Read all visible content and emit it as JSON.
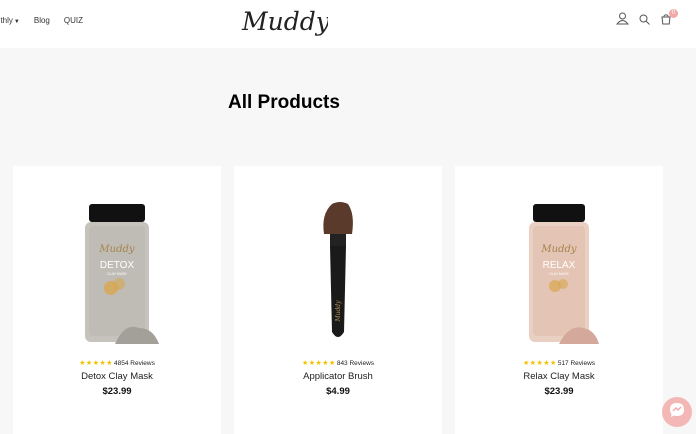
{
  "nav": {
    "items": [
      "nthly",
      "Blog",
      "QUIZ"
    ]
  },
  "brand": {
    "logo": "Muddy"
  },
  "header": {
    "cart_count": "0"
  },
  "page": {
    "title": "All Products"
  },
  "products": [
    {
      "name": "Detox Clay Mask",
      "price": "$23.99",
      "reviews": "4854 Reviews",
      "stars": "★★★★★",
      "jar_label": "DETOX",
      "jar_sub": "CLAY MASK",
      "color": "#bfbcb6"
    },
    {
      "name": "Applicator Brush",
      "price": "$4.99",
      "reviews": "843 Reviews",
      "stars": "★★★★★",
      "brush_label": "Muddy"
    },
    {
      "name": "Relax Clay Mask",
      "price": "$23.99",
      "reviews": "517 Reviews",
      "stars": "★★★★★",
      "jar_label": "RELAX",
      "jar_sub": "CLAY MASK",
      "color": "#e4c4b4"
    }
  ],
  "colors": {
    "accent": "#f3a7a6",
    "star": "#f2c200"
  },
  "icons": [
    "user-icon",
    "search-icon",
    "cart-icon",
    "messenger-icon"
  ]
}
